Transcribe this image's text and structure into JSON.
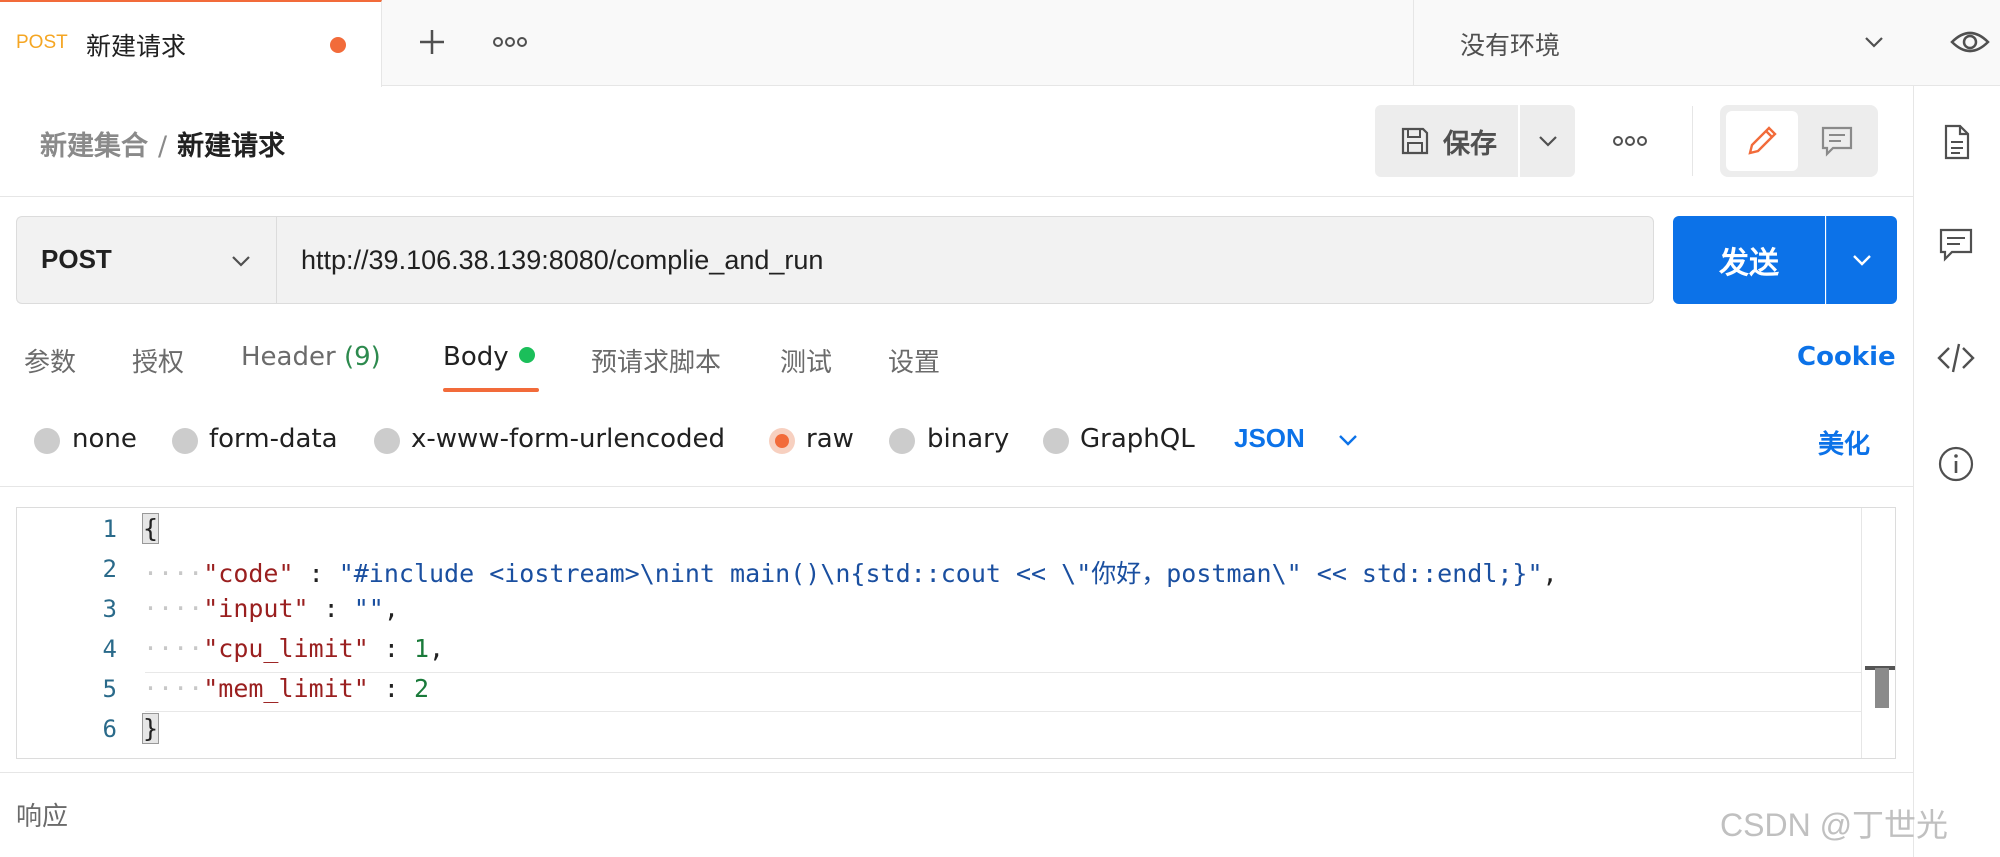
{
  "tab": {
    "method": "POST",
    "title": "新建请求"
  },
  "environment": {
    "label": "没有环境"
  },
  "breadcrumb": {
    "parent": "新建集合",
    "separator": "/",
    "current": "新建请求"
  },
  "toolbar": {
    "save_label": "保存"
  },
  "request": {
    "method": "POST",
    "url": "http://39.106.38.139:8080/complie_and_run",
    "send_label": "发送"
  },
  "request_tabs": {
    "params": "参数",
    "auth": "授权",
    "headers": "Header",
    "headers_count": "(9)",
    "body": "Body",
    "pre_request": "预请求脚本",
    "tests": "测试",
    "settings": "设置",
    "cookie": "Cookie"
  },
  "body_types": {
    "none": "none",
    "form_data": "form-data",
    "urlencoded": "x-www-form-urlencoded",
    "raw": "raw",
    "binary": "binary",
    "graphql": "GraphQL",
    "format": "JSON",
    "beautify": "美化"
  },
  "code": {
    "line_numbers": [
      "1",
      "2",
      "3",
      "4",
      "5",
      "6"
    ],
    "open_brace": "{",
    "close_brace": "}",
    "indent": "····",
    "k_code": "\"code\"",
    "v_code": "\"#include <iostream>\\nint main()\\n{std::cout << \\\"你好，postman\\\" << std::endl;}\"",
    "k_input": "\"input\"",
    "v_input": "\"\"",
    "k_cpu": "\"cpu_limit\"",
    "v_cpu": "1",
    "k_mem": "\"mem_limit\"",
    "v_mem": "2",
    "colon": " : ",
    "comma": ","
  },
  "response": {
    "label": "响应"
  },
  "watermark": "CSDN @丁世光",
  "colors": {
    "accent_orange": "#f26b3a",
    "primary_blue": "#0c72e8",
    "body_dot_green": "#1bbf5a"
  }
}
